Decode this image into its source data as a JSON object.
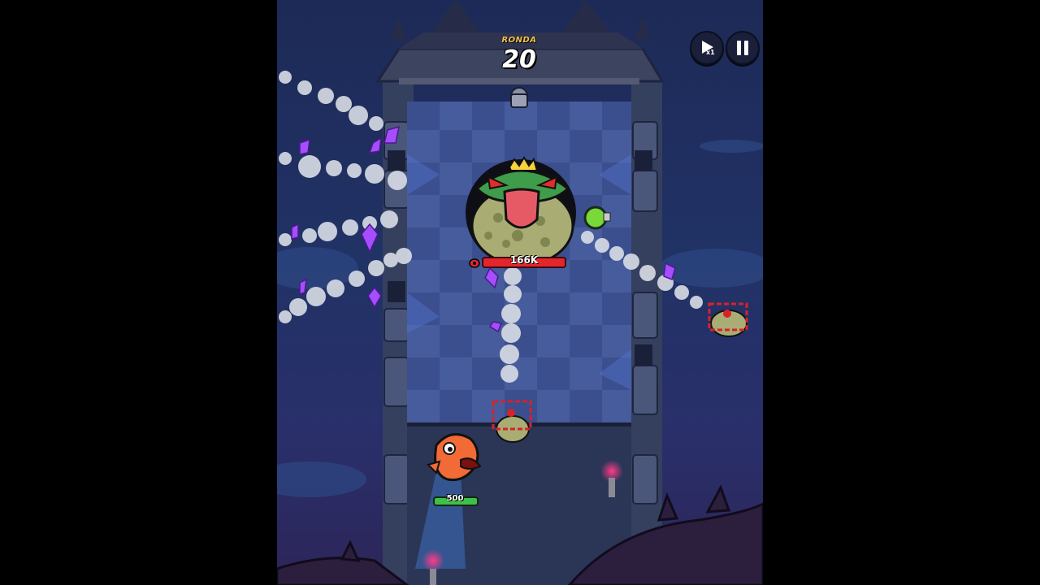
{
  "hud": {
    "round_label": "RONDA",
    "round_value": "20",
    "speed_button_label": "x1",
    "speed_icon": "play-speed-icon",
    "pause_icon": "pause-icon"
  },
  "boss": {
    "name_icon": "frog-king-boss",
    "hp_text": "166K",
    "hp_color": "#e3262c"
  },
  "hero": {
    "icon": "orange-dragon-hero",
    "hp_text": "500",
    "hp_color": "#3fc04a"
  },
  "colors": {
    "gem": "#a64dff",
    "sky": "#213266",
    "tower_floor": "#3b4f8e"
  }
}
